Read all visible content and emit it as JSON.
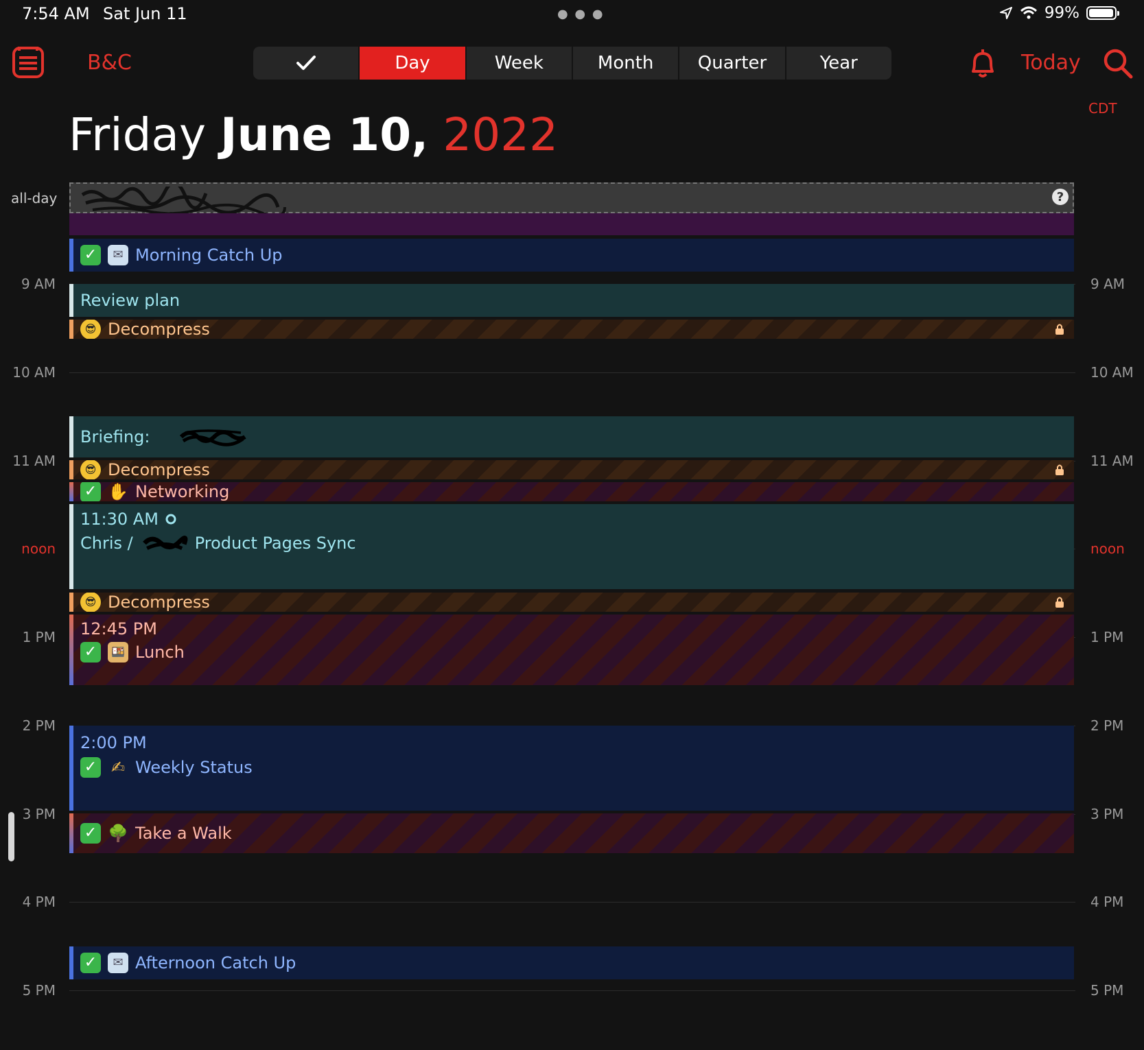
{
  "status_bar": {
    "time": "7:54 AM",
    "date": "Sat Jun 11",
    "battery": "99%"
  },
  "nav": {
    "title": "B&C",
    "segments": [
      {
        "label": "✓",
        "active": false
      },
      {
        "label": "Day",
        "active": true
      },
      {
        "label": "Week",
        "active": false
      },
      {
        "label": "Month",
        "active": false
      },
      {
        "label": "Quarter",
        "active": false
      },
      {
        "label": "Year",
        "active": false
      }
    ],
    "today_label": "Today",
    "timezone": "CDT"
  },
  "heading": {
    "weekday": "Friday",
    "month_day": "June 10",
    "year": "2022"
  },
  "allday_label": "all-day",
  "help_symbol": "?",
  "hours": [
    "9 AM",
    "10 AM",
    "11 AM",
    "noon",
    "1 PM",
    "2 PM",
    "3 PM",
    "4 PM",
    "5 PM"
  ],
  "events": {
    "morning": "Morning Catch Up",
    "review": "Review plan",
    "decompress": "Decompress",
    "briefing": "Briefing:",
    "networking": "Networking",
    "chris_time": "11:30 AM",
    "chris_a": "Chris /",
    "chris_b": "Product Pages Sync",
    "lunch_time": "12:45 PM",
    "lunch": "Lunch",
    "weekly_time": "2:00 PM",
    "weekly": "Weekly Status",
    "walk": "Take a Walk",
    "afternoon": "Afternoon Catch Up"
  },
  "colors": {
    "accent": "#e2332c",
    "background": "#131313"
  },
  "icons": [
    "list-icon",
    "bell-icon",
    "search-icon",
    "lock-icon",
    "check-icon",
    "mail-icon",
    "sunglasses-icon",
    "handshake-icon",
    "lunch-icon",
    "pencil-icon",
    "tree-icon"
  ]
}
